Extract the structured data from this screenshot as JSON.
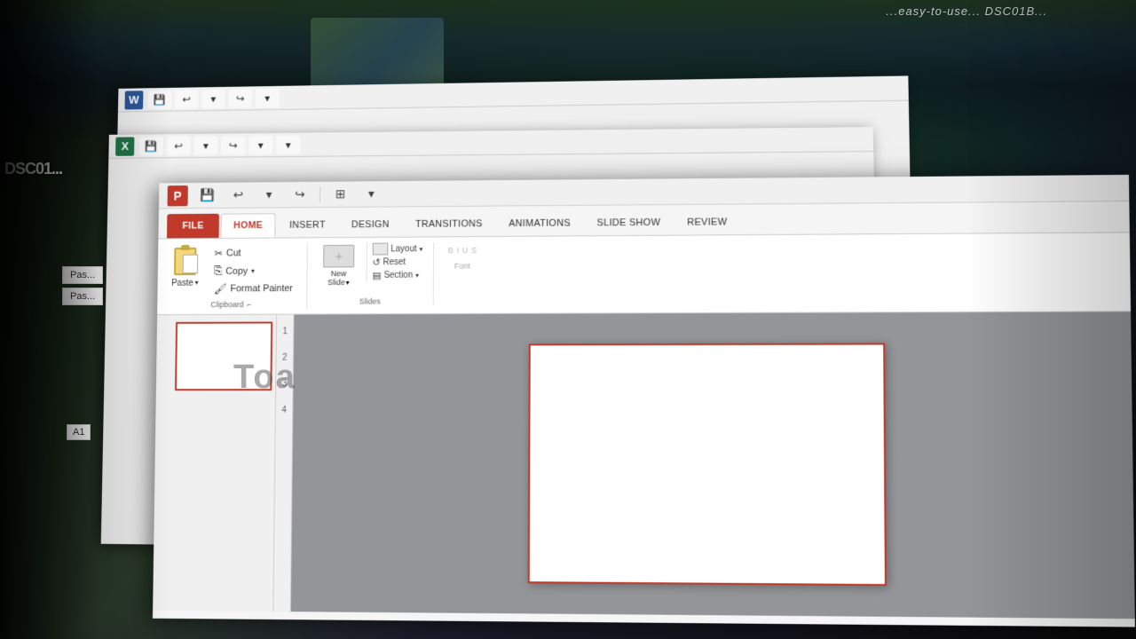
{
  "desktop": {
    "bg_description": "Desktop with nature/trees photo in background"
  },
  "dsc_label": "DSC01...",
  "watermark": "...easy-to-use... DSC01B...",
  "word_window": {
    "title": "Microsoft Word",
    "icon_letter": "W",
    "qat": {
      "save_label": "💾",
      "undo_label": "↩",
      "undo_dropdown": "▾",
      "redo_label": "↪",
      "customize_label": "▾"
    }
  },
  "excel_window": {
    "title": "Microsoft Excel",
    "icon_letter": "X",
    "qat": {
      "save_label": "💾",
      "undo_label": "↩",
      "undo_dropdown": "▾",
      "redo_label": "↪",
      "redo_dropdown": "▾",
      "customize_label": "▾"
    }
  },
  "ppt_window": {
    "title": "Microsoft PowerPoint",
    "icon_letter": "P",
    "qat": {
      "save_label": "💾",
      "undo_label": "↩",
      "undo_dropdown": "▾",
      "redo_label": "↪",
      "customize_label": "▾"
    },
    "tabs": {
      "file": "FILE",
      "home": "HOME",
      "insert": "INSERT",
      "design": "DESIGN",
      "transitions": "TRANSITIONS",
      "animations": "ANIMATIONS",
      "slideshow": "SLIDE SHOW",
      "review": "REVIEW"
    },
    "active_tab": "HOME",
    "clipboard_group": {
      "label": "Clipboard",
      "paste_label": "Paste",
      "paste_arrow": "▾",
      "cut_label": "Cut",
      "copy_label": "Copy",
      "copy_arrow": "▾",
      "format_painter_label": "Format Painter"
    },
    "slides_group": {
      "label": "Slides",
      "new_slide_label": "New\nSlide",
      "new_slide_arrow": "▾",
      "layout_label": "Layout",
      "layout_arrow": "▾",
      "reset_label": "Reset",
      "section_label": "Section",
      "section_arrow": "▾"
    },
    "font_group": {
      "label": "Font"
    }
  },
  "slide_panel": {
    "slide_number": "1",
    "thumb_desc": "Blank white slide"
  },
  "row_numbers": [
    "1",
    "2",
    "3",
    "4"
  ],
  "name_box_value": "A1",
  "toa_text": "Toa"
}
